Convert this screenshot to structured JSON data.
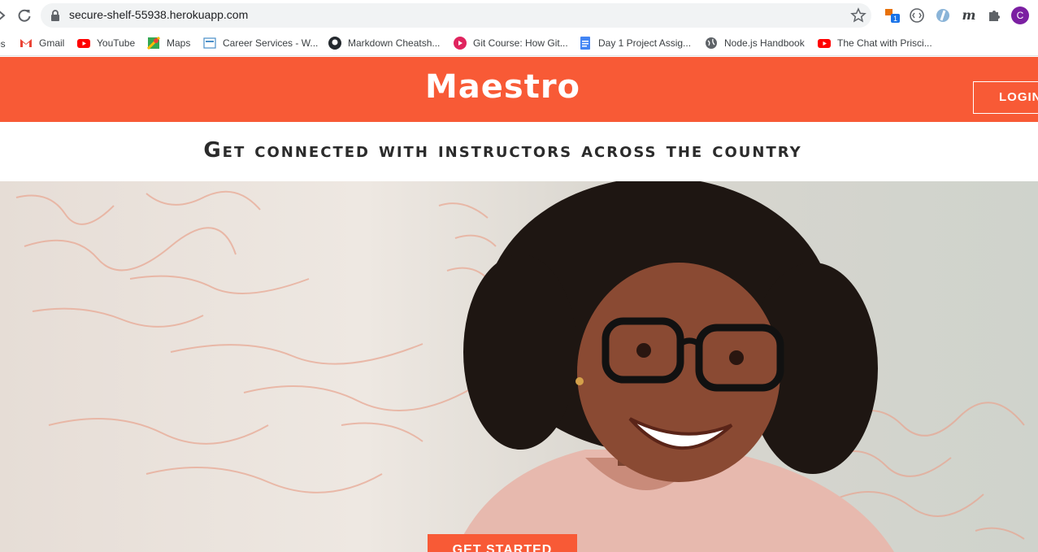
{
  "browser": {
    "url": "secure-shelf-55938.herokuapp.com",
    "profile_initial": "C",
    "extension_badge": "1"
  },
  "bookmarks": {
    "partial_label": "os",
    "items": [
      {
        "label": "Gmail",
        "icon": "gmail-icon"
      },
      {
        "label": "YouTube",
        "icon": "youtube-icon"
      },
      {
        "label": "Maps",
        "icon": "maps-icon"
      },
      {
        "label": "Career Services - W...",
        "icon": "career-services-icon"
      },
      {
        "label": "Markdown Cheatsh...",
        "icon": "github-icon"
      },
      {
        "label": "Git Course: How Git...",
        "icon": "git-course-icon"
      },
      {
        "label": "Day 1 Project Assig...",
        "icon": "google-docs-icon"
      },
      {
        "label": "Node.js Handbook",
        "icon": "globe-icon"
      },
      {
        "label": "The Chat with Prisci...",
        "icon": "youtube-icon"
      }
    ]
  },
  "site": {
    "brand": "Maestro",
    "login_label": "LOGIN",
    "tagline": "Get connected with instructors across the country",
    "cta_label": "GET STARTED",
    "accent_color": "#f85a36"
  }
}
